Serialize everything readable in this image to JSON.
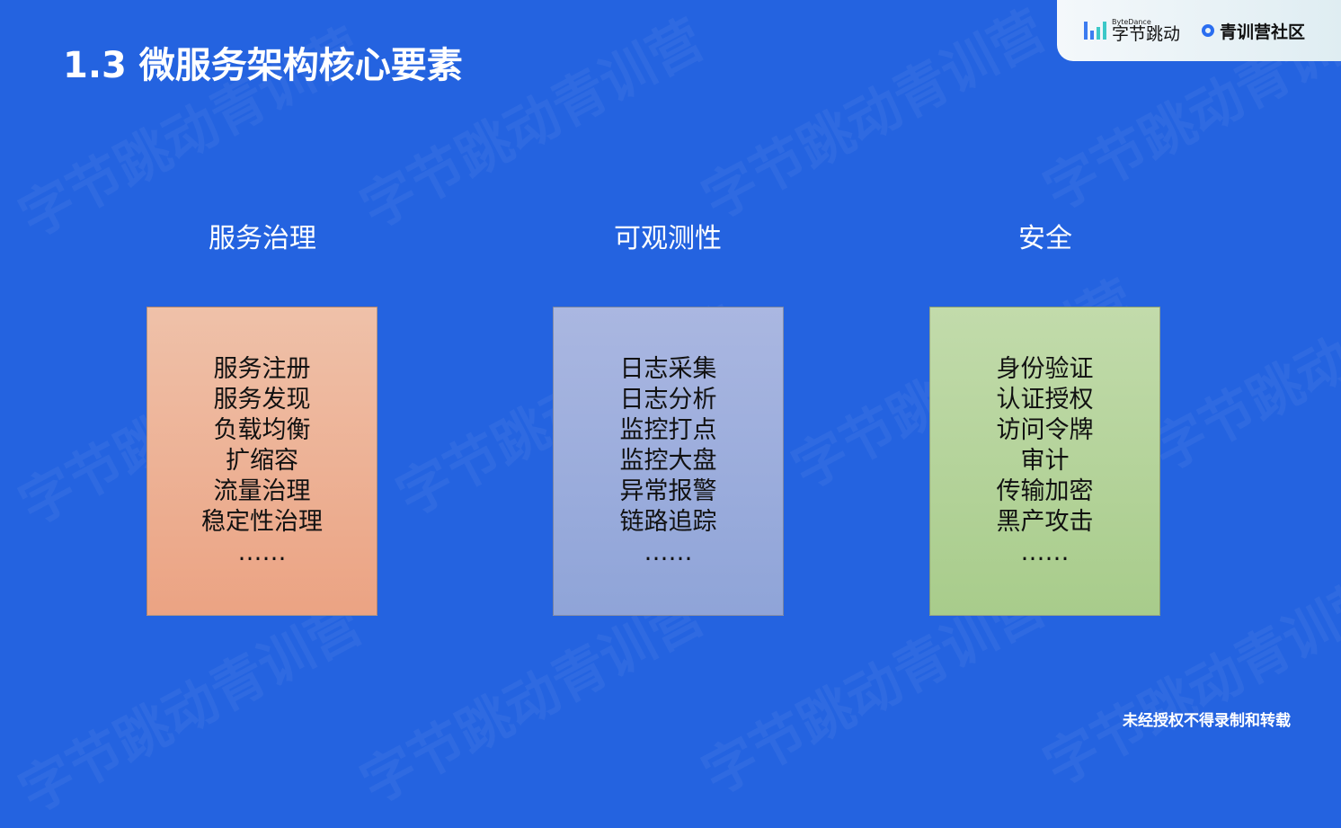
{
  "title": "1.3 微服务架构核心要素",
  "logo": {
    "bytedance_small": "ByteDance",
    "bytedance": "字节跳动",
    "community": "青训营社区"
  },
  "watermark": "字节跳动青训营",
  "columns": [
    {
      "heading": "服务治理",
      "items": [
        "服务注册",
        "服务发现",
        "负载均衡",
        "扩缩容",
        "流量治理",
        "稳定性治理",
        "……"
      ]
    },
    {
      "heading": "可观测性",
      "items": [
        "日志采集",
        "日志分析",
        "监控打点",
        "监控大盘",
        "异常报警",
        "链路追踪",
        "……"
      ]
    },
    {
      "heading": "安全",
      "items": [
        "身份验证",
        "认证授权",
        "访问令牌",
        "审计",
        "传输加密",
        "黑产攻击",
        "……"
      ]
    }
  ],
  "footer": "未经授权不得录制和转载"
}
